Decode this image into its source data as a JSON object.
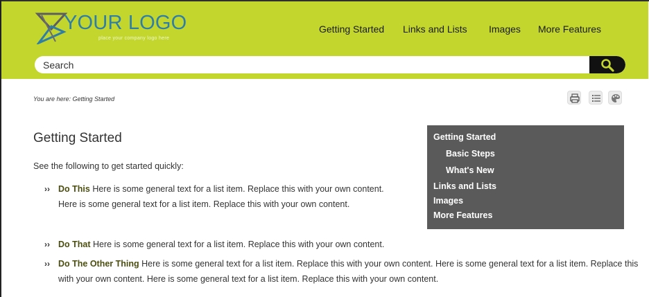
{
  "logo": {
    "text": "YOUR LOGO",
    "tagline": "place your company logo here"
  },
  "nav": {
    "items": [
      {
        "label": "Getting Started"
      },
      {
        "label": "Links and Lists"
      },
      {
        "label": "Images"
      },
      {
        "label": "More Features"
      }
    ]
  },
  "search": {
    "placeholder": "Search",
    "button_icon": "magnifier-icon"
  },
  "breadcrumb": {
    "text": "You are here: Getting Started"
  },
  "toolbar": {
    "icons": [
      "print-icon",
      "list-icon",
      "palette-icon"
    ]
  },
  "main": {
    "title": "Getting Started",
    "intro": "See the following to get started quickly:",
    "items": [
      {
        "term": "Do This",
        "text": " Here is some general text for a list item. Replace this with your own content. Here is some general text for a list item. Replace this with your own content."
      },
      {
        "term": "Do That",
        "text": " Here is some general text for a list item. Replace this with your own content."
      },
      {
        "term": "Do The Other Thing",
        "text": " Here is some general text for a list item. Replace this with your own content. Here is some general text for a list item. Replace this with your own content. Here is some general text for a list item. Replace this with your own content."
      }
    ]
  },
  "toc": {
    "items": [
      {
        "label": "Getting Started"
      },
      {
        "label": "Basic Steps"
      },
      {
        "label": "What's New"
      },
      {
        "label": "Links and Lists"
      },
      {
        "label": "Images"
      },
      {
        "label": "More Features"
      }
    ]
  },
  "colors": {
    "header_bg": "#c2d62e",
    "logo_text": "#2f7ea6",
    "toc_bg": "#5a5a5a",
    "search_button": "#111111",
    "term_text": "#4b4e0f"
  }
}
